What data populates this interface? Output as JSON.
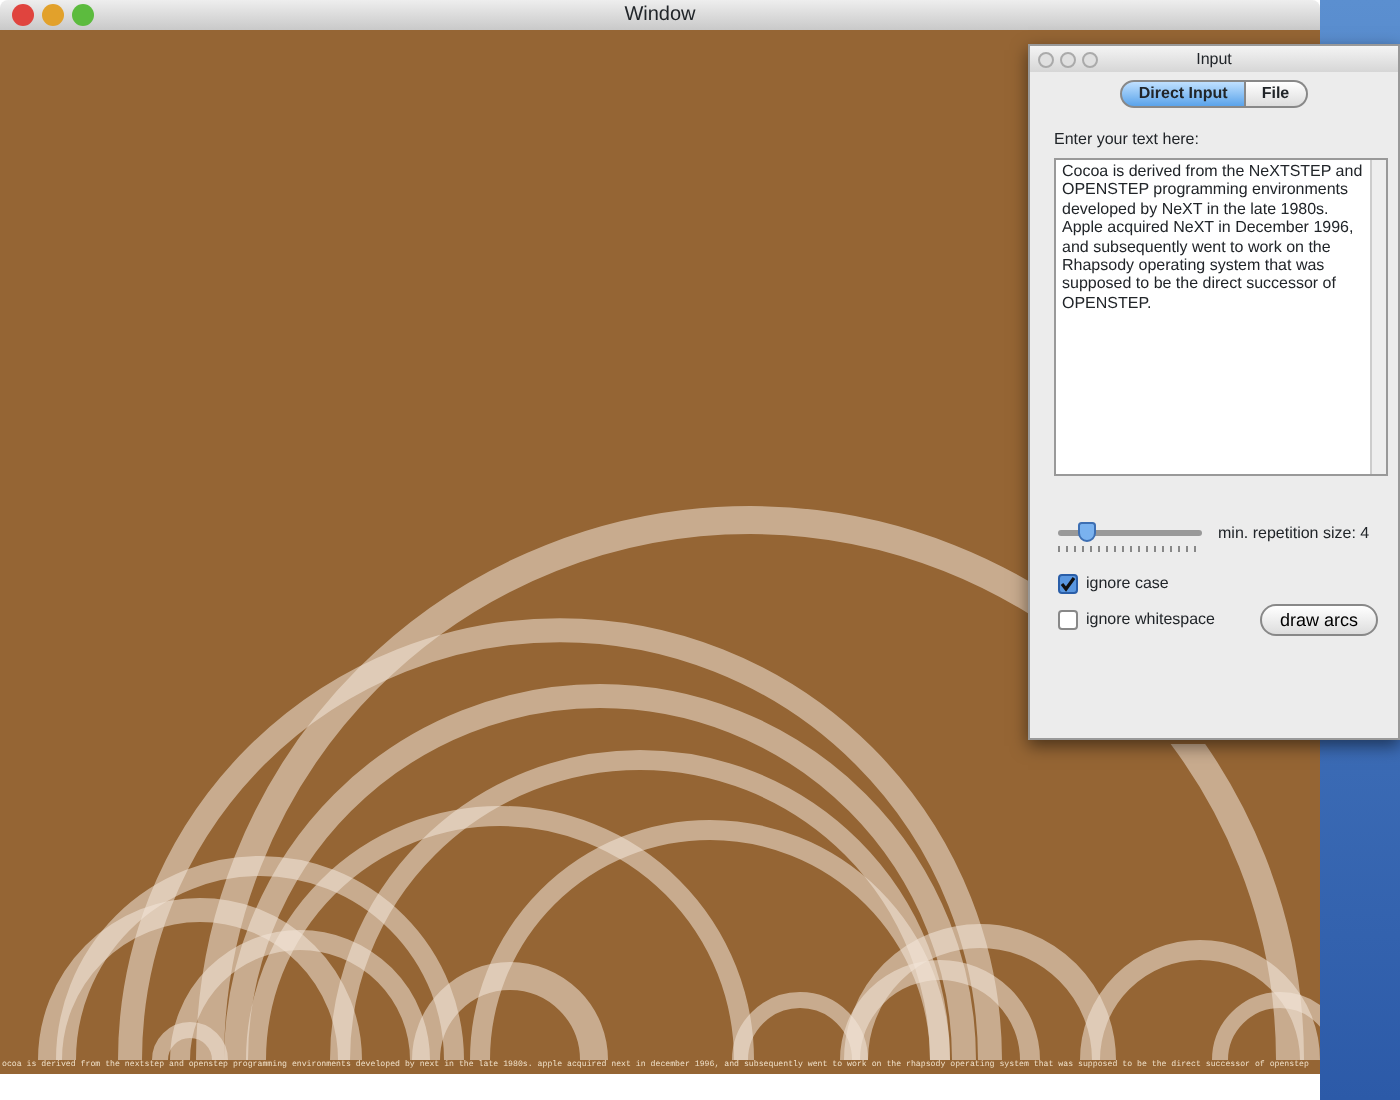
{
  "window": {
    "title": "Window"
  },
  "canvas_caption": "ocoa is derived from the nextstep and openstep programming environments developed by next in the late 1980s. apple acquired next in december 1996, and subsequently went to work on the rhapsody operating system that was supposed to be the direct successor of openstep",
  "input_panel": {
    "title": "Input",
    "tabs": [
      {
        "label": "Direct Input",
        "selected": true
      },
      {
        "label": "File",
        "selected": false
      }
    ],
    "prompt": "Enter your text here:",
    "text": "Cocoa is derived from the NeXTSTEP and OPENSTEP programming environments developed by NeXT in the late 1980s. Apple acquired NeXT in December 1996, and subsequently went to work on the Rhapsody operating system that was supposed to be the direct successor of OPENSTEP.",
    "slider": {
      "level": 0.2,
      "reading": "min. repetition size: 4"
    },
    "checkboxes": [
      {
        "label": "ignore case",
        "checked": true
      },
      {
        "label": "ignore whitespace",
        "checked": false
      }
    ],
    "button": "draw arcs"
  }
}
